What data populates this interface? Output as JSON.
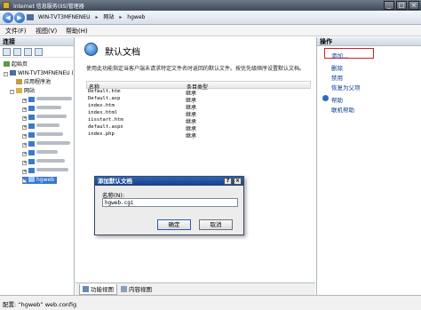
{
  "window": {
    "title": "Internet 信息服务(IIS)管理器",
    "controls": [
      "_",
      "□",
      "×"
    ]
  },
  "address": {
    "crumbs": [
      "WIN-TVT3MFNENEU",
      "网站",
      "hgweb"
    ]
  },
  "menu": {
    "items": [
      "文件(F)",
      "视图(V)",
      "帮助(H)"
    ]
  },
  "connections": {
    "title": "连接",
    "tree": {
      "start_page": "起始页",
      "server": "WIN-TVT3MFNENEU (",
      "app_pools": "应用程序池",
      "sites": "网站",
      "selected_site": "hgweb"
    }
  },
  "main": {
    "title": "默认文档",
    "description": "使用此功能指定当客户端未请求特定文件名时返回的默认文件。按优先级顺序设置默认文档。",
    "columns": [
      "名称",
      "条目类型"
    ],
    "rows": [
      {
        "name": "Default.htm",
        "type": "继承"
      },
      {
        "name": "Default.asp",
        "type": "继承"
      },
      {
        "name": "index.htm",
        "type": "继承"
      },
      {
        "name": "index.html",
        "type": "继承"
      },
      {
        "name": "iisstart.htm",
        "type": "继承"
      },
      {
        "name": "default.aspx",
        "type": "继承"
      },
      {
        "name": "index.php",
        "type": "继承"
      }
    ],
    "view_tabs": {
      "features": "功能视图",
      "content": "内容视图"
    }
  },
  "actions": {
    "title": "操作",
    "add": "添加...",
    "remove": "删除",
    "disable": "禁用",
    "revert": "恢复为父项",
    "help": "帮助",
    "online_help": "联机帮助"
  },
  "status": {
    "text": "配置: “hgweb” web.config"
  },
  "dialog": {
    "title": "添加默认文档",
    "help_btn": "?",
    "close_btn": "×",
    "name_label": "名称(N):",
    "name_value": "hgweb.cgi",
    "ok": "确定",
    "cancel": "取消"
  }
}
